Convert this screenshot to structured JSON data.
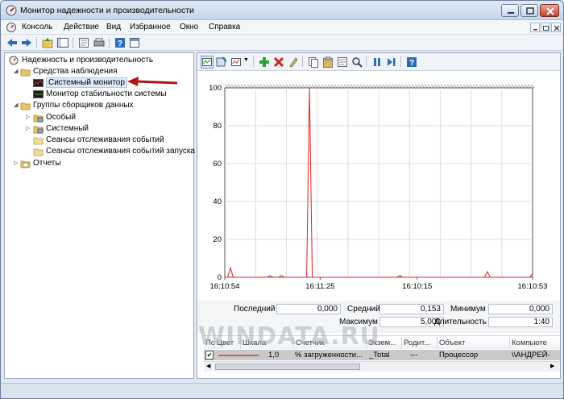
{
  "window": {
    "title": "Монитор надежности и производительности"
  },
  "menu": {
    "items": [
      "Консоль",
      "Действие",
      "Вид",
      "Избранное",
      "Окно",
      "Справка"
    ]
  },
  "tree": {
    "root": "Надежность и производительность",
    "items": [
      {
        "label": "Средства наблюдения",
        "icon": "folder-icon"
      },
      {
        "label": "Системный монитор",
        "icon": "system-monitor-icon",
        "selected": true
      },
      {
        "label": "Монитор стабильности системы",
        "icon": "stability-monitor-icon"
      },
      {
        "label": "Группы сборщиков данных",
        "icon": "folder-icon"
      },
      {
        "label": "Особый",
        "icon": "collector-icon"
      },
      {
        "label": "Системный",
        "icon": "collector-icon"
      },
      {
        "label": "Сеансы отслеживания событий",
        "icon": "event-trace-icon"
      },
      {
        "label": "Сеансы отслеживания событий запуска",
        "icon": "event-trace-icon"
      },
      {
        "label": "Отчеты",
        "icon": "reports-icon"
      }
    ]
  },
  "colors": {
    "arrow": "#b01818",
    "line": "#e02020",
    "accent": "#2f6db5"
  },
  "stats": {
    "last_label": "Последний",
    "last_value": "0,000",
    "avg_label": "Средний",
    "avg_value": "0,153",
    "min_label": "Минимум",
    "min_value": "0,000",
    "max_label": "Максимум",
    "max_value": "5,000",
    "dur_label": "Длительность",
    "dur_value": "1:40"
  },
  "table": {
    "headers": [
      "Пока...",
      "Цвет",
      "Шкала",
      "Счетчик",
      "Экзем...",
      "Родит...",
      "Объект",
      "Компьюте"
    ],
    "row": {
      "checked": "✔",
      "scale": "1,0",
      "counter": "% загруженности...",
      "instance": "_Total",
      "parent": "---",
      "object": "Процессор",
      "computer": "\\\\АНДРЕЙ-"
    }
  },
  "watermark": "WINDATA.RU",
  "chart_data": {
    "type": "line",
    "title": "",
    "xlabel": "",
    "ylabel": "",
    "ylim": [
      0,
      100
    ],
    "yticks": [
      0,
      20,
      40,
      60,
      80,
      100
    ],
    "xticks": [
      "16:10:54",
      "16:11:25",
      "16:10:15",
      "16:10:53"
    ],
    "grid": true,
    "series": [
      {
        "values": [
          0,
          0,
          5,
          0,
          0,
          0,
          0,
          0,
          0,
          0,
          0,
          0,
          0,
          0,
          0,
          0,
          1,
          0,
          0,
          0,
          1,
          0,
          0,
          0,
          0,
          0,
          0,
          0,
          0,
          0,
          100,
          0,
          0,
          0,
          0,
          0,
          0,
          0,
          0,
          0,
          0,
          0,
          0,
          0,
          0,
          0,
          0,
          0,
          0,
          0,
          0,
          0,
          0,
          0,
          0,
          0,
          0,
          0,
          0,
          0,
          0,
          0,
          1,
          0,
          0,
          0,
          0,
          0,
          0,
          0,
          0,
          0,
          0,
          0,
          0,
          0,
          0,
          0,
          0,
          0,
          0,
          0,
          0,
          0,
          0,
          0,
          0,
          0,
          0,
          0,
          0,
          0,
          0,
          3,
          0,
          0,
          0,
          0,
          0,
          0,
          0,
          0,
          0,
          0,
          0,
          0,
          0,
          0,
          0,
          2
        ]
      }
    ]
  }
}
